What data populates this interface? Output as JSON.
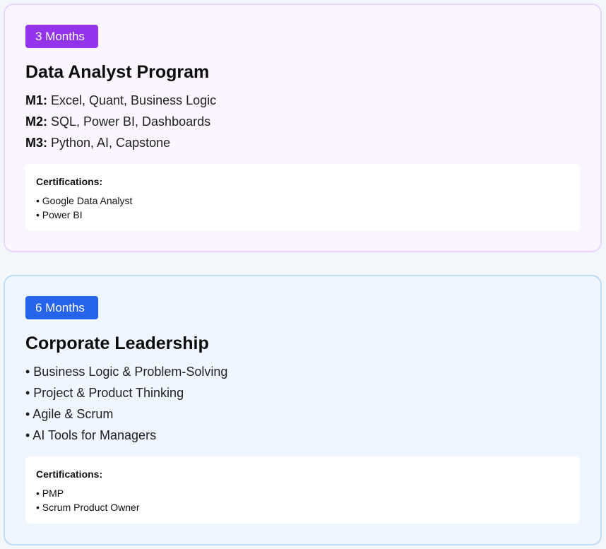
{
  "programs": [
    {
      "badge": "3 Months",
      "title": "Data Analyst Program",
      "modules": [
        {
          "key": "M1:",
          "text": " Excel, Quant, Business Logic"
        },
        {
          "key": "M2:",
          "text": " SQL, Power BI, Dashboards"
        },
        {
          "key": "M3:",
          "text": " Python, AI, Capstone"
        }
      ],
      "certifications_title": "Certifications:",
      "certifications": [
        "• Google Data Analyst",
        "• Power BI"
      ],
      "accent": "#9333ea"
    },
    {
      "badge": "6 Months",
      "title": "Corporate Leadership",
      "topics": [
        "• Business Logic & Problem-Solving",
        "• Project & Product Thinking",
        "• Agile & Scrum",
        "• AI Tools for Managers"
      ],
      "certifications_title": "Certifications:",
      "certifications": [
        "• PMP",
        "• Scrum Product Owner"
      ],
      "accent": "#2563eb"
    }
  ]
}
